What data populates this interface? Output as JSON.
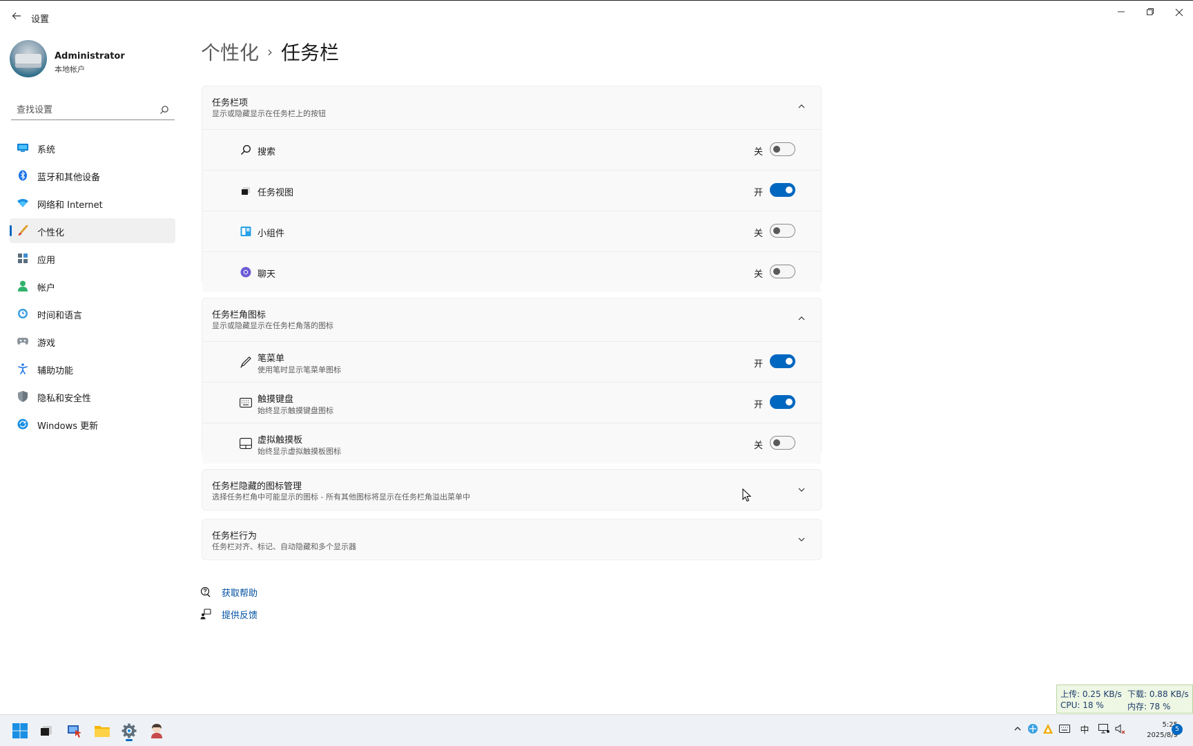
{
  "window": {
    "title": "设置",
    "back_icon": "back-arrow-icon",
    "minimize_icon": "minimize-icon",
    "restore_icon": "restore-icon",
    "close_icon": "close-icon"
  },
  "profile": {
    "name": "Administrator",
    "account_type": "本地帐户"
  },
  "search": {
    "placeholder": "查找设置",
    "icon": "search-icon"
  },
  "sidebar": {
    "items": [
      {
        "label": "系统",
        "icon": "system-icon",
        "active": false
      },
      {
        "label": "蓝牙和其他设备",
        "icon": "bluetooth-icon",
        "active": false
      },
      {
        "label": "网络和 Internet",
        "icon": "network-icon",
        "active": false
      },
      {
        "label": "个性化",
        "icon": "personalization-brush-icon",
        "active": true
      },
      {
        "label": "应用",
        "icon": "apps-icon",
        "active": false
      },
      {
        "label": "帐户",
        "icon": "account-icon",
        "active": false
      },
      {
        "label": "时间和语言",
        "icon": "time-language-icon",
        "active": false
      },
      {
        "label": "游戏",
        "icon": "gaming-icon",
        "active": false
      },
      {
        "label": "辅助功能",
        "icon": "accessibility-icon",
        "active": false
      },
      {
        "label": "隐私和安全性",
        "icon": "privacy-shield-icon",
        "active": false
      },
      {
        "label": "Windows 更新",
        "icon": "windows-update-icon",
        "active": false
      }
    ]
  },
  "breadcrumb": {
    "parent": "个性化",
    "separator": "›",
    "current": "任务栏"
  },
  "sections": {
    "taskbar_items": {
      "title": "任务栏项",
      "subtitle": "显示或隐藏显示在任务栏上的按钮",
      "expanded": true,
      "rows": [
        {
          "label": "搜索",
          "icon": "search-icon",
          "state": "关",
          "on": false
        },
        {
          "label": "任务视图",
          "icon": "task-view-icon",
          "state": "开",
          "on": true
        },
        {
          "label": "小组件",
          "icon": "widgets-icon",
          "state": "关",
          "on": false
        },
        {
          "label": "聊天",
          "icon": "chat-icon",
          "state": "关",
          "on": false
        }
      ]
    },
    "corner_icons": {
      "title": "任务栏角图标",
      "subtitle": "显示或隐藏显示在任务栏角落的图标",
      "expanded": true,
      "rows": [
        {
          "label": "笔菜单",
          "sub": "使用笔时显示笔菜单图标",
          "icon": "pen-icon",
          "state": "开",
          "on": true
        },
        {
          "label": "触摸键盘",
          "sub": "始终显示触摸键盘图标",
          "icon": "keyboard-icon",
          "state": "开",
          "on": true
        },
        {
          "label": "虚拟触摸板",
          "sub": "始终显示虚拟触摸板图标",
          "icon": "touchpad-icon",
          "state": "关",
          "on": false
        }
      ]
    },
    "hidden_icons": {
      "title": "任务栏隐藏的图标管理",
      "subtitle": "选择任务栏角中可能显示的图标 - 所有其他图标将显示在任务栏角溢出菜单中",
      "expanded": false
    },
    "behaviors": {
      "title": "任务栏行为",
      "subtitle": "任务栏对齐、标记、自动隐藏和多个显示器",
      "expanded": false
    }
  },
  "links": {
    "help": "获取帮助",
    "feedback": "提供反馈"
  },
  "netmon": {
    "upload": "上传: 0.25 KB/s",
    "download": "下载: 0.88 KB/s",
    "cpu": "CPU: 18 %",
    "mem": "内存: 78 %"
  },
  "taskbar": {
    "apps": [
      "windows-start-icon",
      "task-view-icon",
      "remote-desktop-icon",
      "file-explorer-icon",
      "settings-gear-icon",
      "app-character-icon"
    ],
    "tray": {
      "chevron": "show-hidden-icons-icon",
      "ime": "中",
      "time": "5:25",
      "date": "2025/8/9",
      "notifications": "5"
    }
  },
  "colors": {
    "accent": "#0067c0",
    "window_bg": "#ffffff",
    "card_bg": "#f9f9f9"
  }
}
